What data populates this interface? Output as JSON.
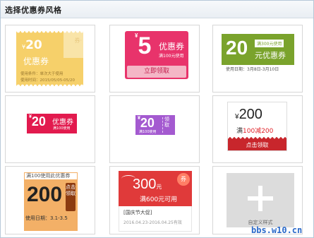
{
  "dialog": {
    "title": "选择优惠券风格"
  },
  "coupons": [
    {
      "currency": "¥",
      "amount": "20",
      "name": "优惠券",
      "stub": "券·",
      "line1": "使用条件：单次大于使用",
      "line2": "使用时间：2015/05/05-05/20"
    },
    {
      "currency": "¥",
      "amount": "5",
      "name": "优惠券",
      "condition": "满100元使用",
      "button": "立即领取"
    },
    {
      "amount": "20",
      "condition": "满300元使用",
      "name": "元优惠券",
      "date": "使用日期：3月8日-3月10日"
    },
    {
      "currency": "¥",
      "amount": "20",
      "name": "优惠券",
      "condition": "满100使用"
    },
    {
      "currency": "¥",
      "amount": "20",
      "condition": "满100使用",
      "side": "领取"
    },
    {
      "currency": "¥",
      "amount": "200",
      "condition_prefix": "满",
      "condition_value": "100减200",
      "button": "点击领取"
    },
    {
      "header": "满100使用此优惠券",
      "amount": "200",
      "side_button": "点击领取",
      "date": "使用日期：3.1-3.5"
    },
    {
      "amount": "300",
      "unit": "元",
      "condition": "满600元可用",
      "stamp": "券",
      "title": "[国庆节大促]",
      "date": "2016.04.23-2016.04.25有效"
    }
  ],
  "custom": {
    "label": "自定义样式"
  },
  "watermark": "bbs.w10.cn"
}
